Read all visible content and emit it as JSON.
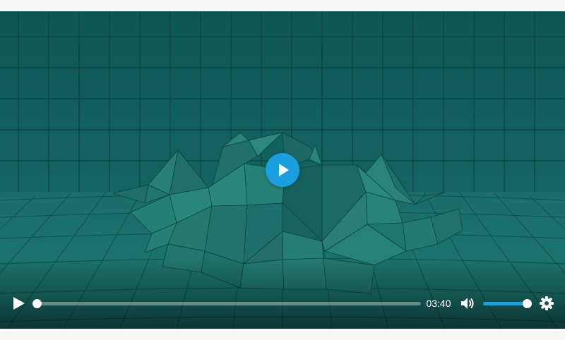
{
  "player": {
    "current_time": "03:40",
    "progress": 0.0,
    "volume": 1.0,
    "accent_color": "#1a9fe0",
    "icons": {
      "big_play": "play-icon",
      "play": "play-icon",
      "mute": "volume-icon",
      "settings": "gear-icon"
    }
  }
}
